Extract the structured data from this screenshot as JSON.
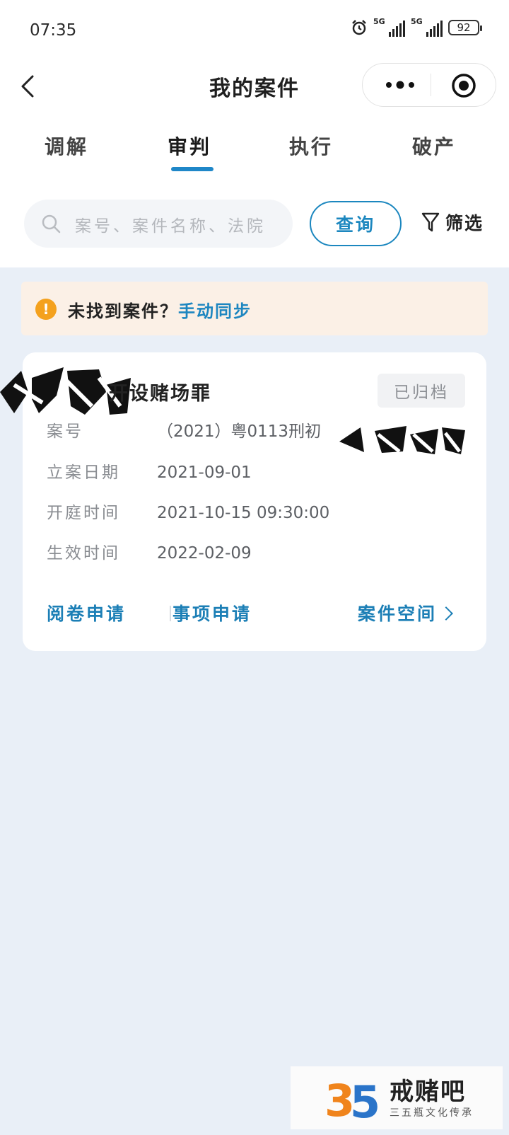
{
  "status_bar": {
    "time": "07:35",
    "network_1": "5G",
    "network_2": "5G",
    "battery": "92",
    "icons": [
      "alarm-icon",
      "signal-icon",
      "signal-icon",
      "battery-icon"
    ]
  },
  "header": {
    "title": "我的案件",
    "icons": [
      "back-arrow-icon",
      "more-dots-icon",
      "target-circle-icon"
    ]
  },
  "tabs": [
    {
      "label": "调解"
    },
    {
      "label": "审判"
    },
    {
      "label": "执行"
    },
    {
      "label": "破产"
    }
  ],
  "active_tab": "审判",
  "search": {
    "placeholder": "案号、案件名称、法院",
    "query_label": "查询",
    "filter_label": "筛选"
  },
  "notice": {
    "text": "未找到案件？",
    "link": "手动同步"
  },
  "case_card": {
    "name": "…设赌场罪",
    "name_visible": "开设赌场罪",
    "status": "已归档",
    "fields": [
      {
        "label": "案号",
        "value": "（2021）粤0113刑初"
      },
      {
        "label": "立案日期",
        "value": "2021-09-01"
      },
      {
        "label": "开庭时间",
        "value": "2021-10-15 09:30:00"
      },
      {
        "label": "生效时间",
        "value": "2022-02-09"
      }
    ],
    "actions": {
      "review": "阅卷申请",
      "matters": "事项申请",
      "space": "案件空间"
    }
  },
  "watermark": {
    "name": "戒赌吧",
    "subtitle": "三五瓶文化传承"
  },
  "colors": {
    "accent": "#1c87bf",
    "background": "#e9eff7",
    "notice_bg": "#fbf0e6",
    "warning": "#f4a11d"
  }
}
